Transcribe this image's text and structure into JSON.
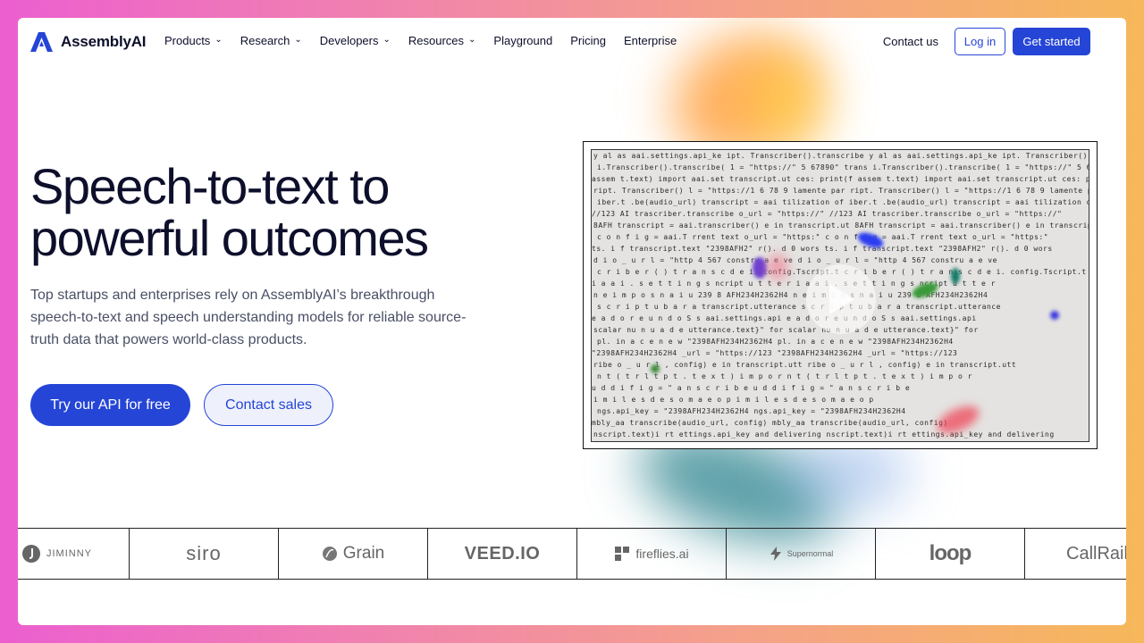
{
  "nav": {
    "brand": "AssemblyAI",
    "menu": [
      {
        "label": "Products",
        "dropdown": true
      },
      {
        "label": "Research",
        "dropdown": true
      },
      {
        "label": "Developers",
        "dropdown": true
      },
      {
        "label": "Resources",
        "dropdown": true
      },
      {
        "label": "Playground",
        "dropdown": false
      },
      {
        "label": "Pricing",
        "dropdown": false
      },
      {
        "label": "Enterprise",
        "dropdown": false
      }
    ],
    "contact_label": "Contact us",
    "login_label": "Log in",
    "get_started_label": "Get started"
  },
  "hero": {
    "title_line1": "Speech-to-text to",
    "title_line2": "powerful outcomes",
    "subtitle": "Top startups and enterprises rely on AssemblyAI’s breakthrough speech-to-text and speech understanding models for reliable source-truth data that powers world-class products.",
    "primary_cta": "Try our API for free",
    "secondary_cta": "Contact sales"
  },
  "video": {
    "icon": "play-icon",
    "code_lines": [
      "y al as aai.settings.api_ke   ipt.   Transcriber().transcribe",
      "i.Transcriber().transcribe(   1 = \"https://\"  5 67890\" trans",
      "assem  t.text) import  aai.set   transcript.ut   ces: print(f",
      "ript. Transcriber()   l = \"https://1  6 78 9 lamente par",
      "iber.t .be(audio_url) transcript = aai  tilization of",
      "//123  AI  trascriber.transcribe  o_url = \"https://\"",
      "8AFH  transcript = aai.transcriber()  e in transcript.ut",
      "   c o n f i g = aai.T  rrent text  o_url = \"https:\"",
      "ts.   i f   transcript.text  \"2398AFH2\"  r(). d 0 wors",
      "d i o _ u r l = \"http  4  567  constru  a e ve",
      "c r i b e r ( ) t r a n s c  d e  i.  config.Tscript.t",
      "  i  a a i . s e t t i n g s  ncript  u t t e r",
      "n  e i m  p  o s  n  a i u  239 8 AFH234H2362H4",
      "s c r i p t   u  b  a  r a  transcript.utterance",
      "  e  a d o r e  u n d o S s  aai.settings.api",
      "scalar nu  n  u a  d e  utterance.text}\" for",
      "pl.  in   a  c  e  n e w  \"2398AFH234H2362H4",
      "  \"2398AFH234H2362H4  _url = \"https://123",
      "ribe  o _ u r l ,  config)  e in transcript.utt",
      "n t ( t r  l t  p t . t e x t )  i m p o r",
      "u d d i  f i g = \"  a n s c r i b e  ",
      "      i  m i l e s  d e  s o m a  e o p",
      "   ngs.api_key = \"2398AFH234H2362H4",
      " mbly_aa  transcribe(audio_url, config)",
      "nscript.text)i rt  ettings.api_key  and delivering"
    ]
  },
  "logos": [
    {
      "name": "Jiminny",
      "text": "JIMINNY"
    },
    {
      "name": "Siro",
      "text": "siro"
    },
    {
      "name": "Grain",
      "text": "Grain"
    },
    {
      "name": "VEED.IO",
      "text": "VEED.IO"
    },
    {
      "name": "fireflies.ai",
      "text": "fireflies.ai"
    },
    {
      "name": "Supernormal",
      "text": "Supernormal"
    },
    {
      "name": "loop",
      "text": "loop"
    },
    {
      "name": "CallRail",
      "text": "CallRail"
    }
  ],
  "colors": {
    "primary": "#2545d6",
    "text_dark": "#0d0f2b",
    "text_muted": "#4a4f66"
  }
}
